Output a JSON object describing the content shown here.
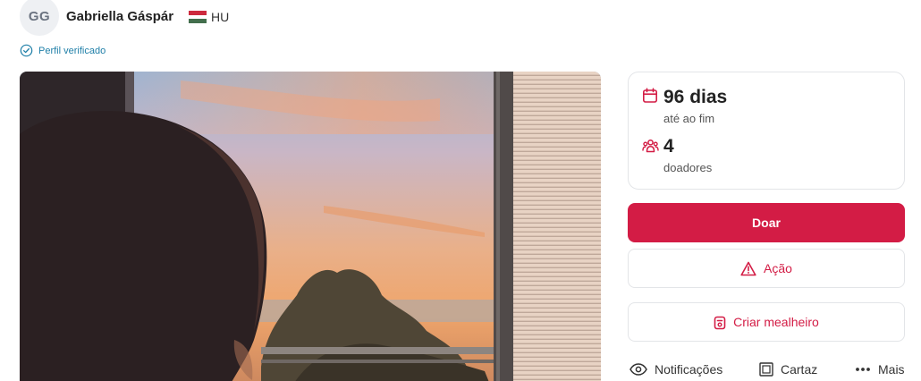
{
  "profile": {
    "initials": "GG",
    "name": "Gabriella Gáspár",
    "country": "HU",
    "flag_colors": [
      "#cd2a3e",
      "#ffffff",
      "#436f4d"
    ],
    "verified_label": "Perfil verificado",
    "verified_icon": "check-circle-icon"
  },
  "stats": {
    "days": {
      "value": "96 dias",
      "label": "até ao fim",
      "icon": "calendar-icon"
    },
    "donors": {
      "value": "4",
      "label": "doadores",
      "icon": "people-icon"
    }
  },
  "actions": {
    "donate_label": "Doar",
    "action_label": "Ação",
    "action_icon": "alert-triangle-icon",
    "piggybank_label": "Criar mealheiro",
    "piggybank_icon": "piggybank-icon"
  },
  "secondary_actions": {
    "notifications_label": "Notificações",
    "poster_label": "Cartaz",
    "more_label": "Mais"
  },
  "colors": {
    "accent": "#d31c45",
    "verified": "#1f7fa8"
  }
}
